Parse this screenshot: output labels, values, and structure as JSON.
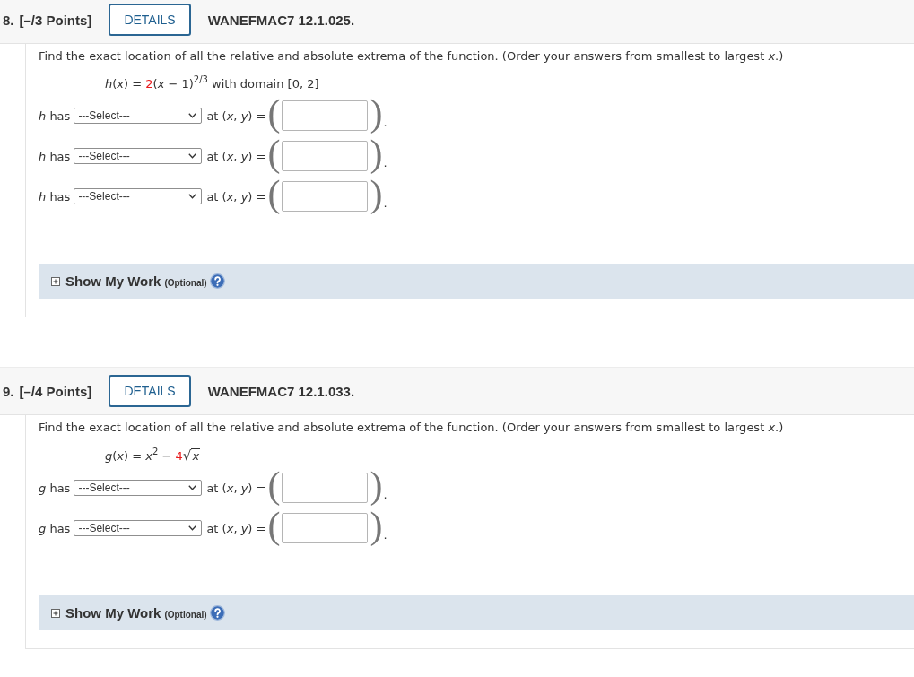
{
  "questions": [
    {
      "number": "8.",
      "points": "[–/3 Points]",
      "details": "DETAILS",
      "code": "WANEFMAC7 12.1.025.",
      "prompt": "Find the exact location of all the relative and absolute extrema of the function. (Order your answers from smallest to largest *x*.)",
      "formula": {
        "lhs": "*h*(*x*) = ",
        "coefficient": "2",
        "rest": "(*x* − 1)$^{2/3}$ with domain [0, 2]"
      },
      "answers": [
        {
          "label": "*h* has",
          "select": "---Select---",
          "coordinates_label": "at (*x*, *y*) =",
          "open_paren": "(",
          "close_paren": ")",
          "end": "."
        },
        {
          "label": "*h* has",
          "select": "---Select---",
          "coordinates_label": "at (*x*, *y*) =",
          "open_paren": "(",
          "close_paren": ")",
          "end": "."
        },
        {
          "label": "*h* has",
          "select": "---Select---",
          "coordinates_label": "at (*x*, *y*) =",
          "open_paren": "(",
          "close_paren": ")",
          "end": "."
        }
      ],
      "work": {
        "expanded": false,
        "label": "Show My Work",
        "note": "(Optional)"
      }
    },
    {
      "number": "9.",
      "points": "[–/4 Points]",
      "details": "DETAILS",
      "code": "WANEFMAC7 12.1.033.",
      "prompt": "Find the exact location of all the relative and absolute extrema of the function. (Order your answers from smallest to largest *x*.)",
      "formula": {
        "lhs": "*g*(*x*) = *x*$^{2}$ − ",
        "coefficient": "4",
        "radical": "√",
        "radicand": "*x*"
      },
      "answers": [
        {
          "label": "*g* has",
          "select": "---Select---",
          "coordinates_label": "at (*x*, *y*) =",
          "open_paren": "(",
          "close_paren": ")",
          "end": "."
        },
        {
          "label": "*g* has",
          "select": "---Select---",
          "coordinates_label": "at (*x*, *y*) =",
          "open_paren": "(",
          "close_paren": ")",
          "end": "."
        }
      ],
      "work": {
        "expanded": false,
        "label": "Show My Work",
        "note": "(Optional)"
      }
    }
  ]
}
